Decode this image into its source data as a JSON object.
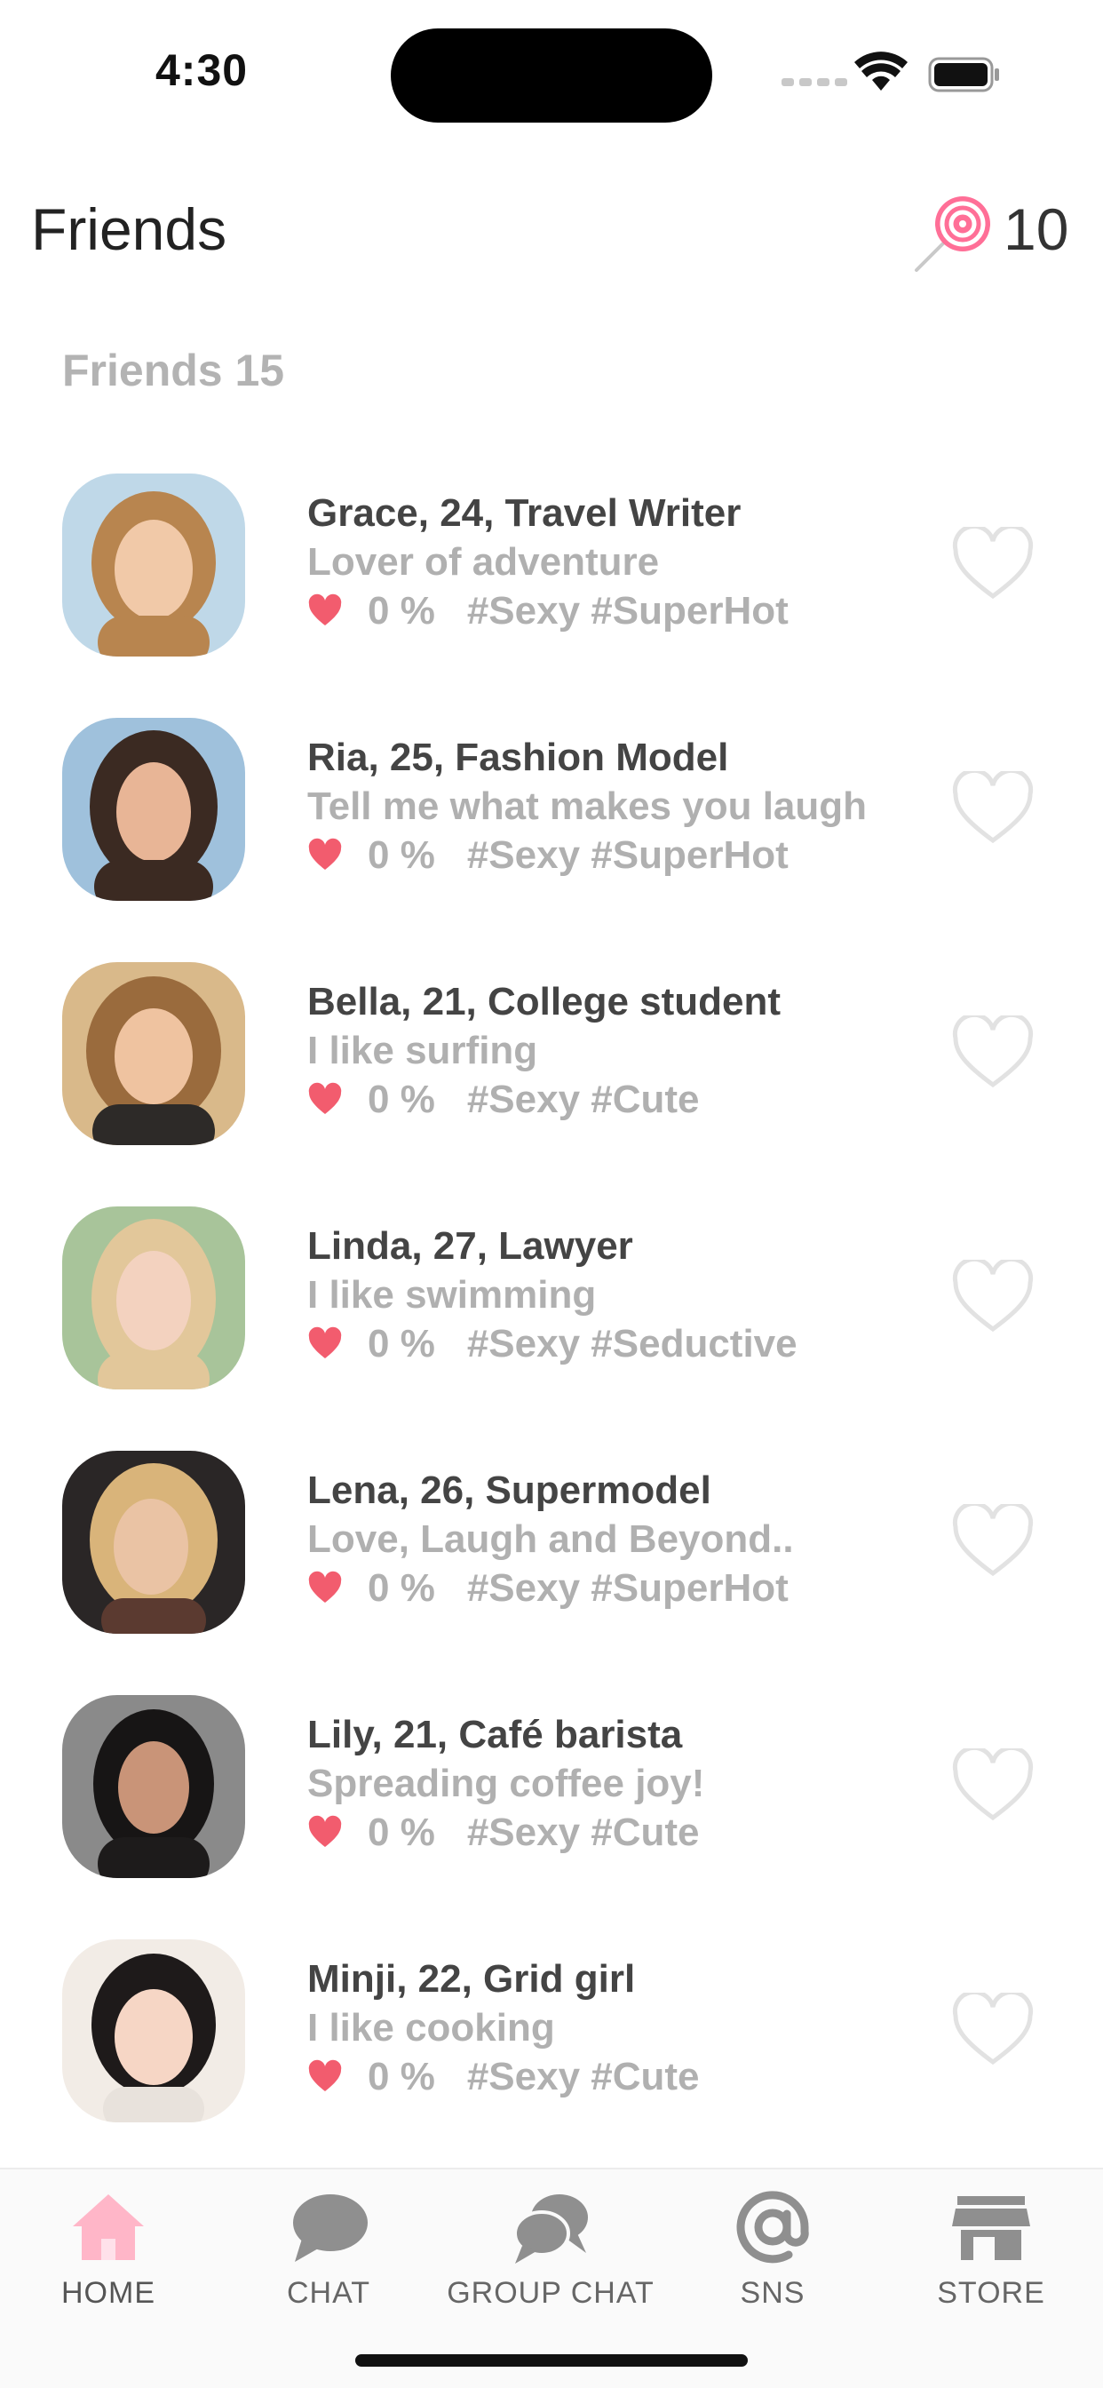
{
  "status_bar": {
    "time": "4:30"
  },
  "header": {
    "title": "Friends",
    "candy_count": "10",
    "candy_icon": "lollipop-icon"
  },
  "section": {
    "label": "Friends 15"
  },
  "colors": {
    "accent_pink": "#ffb6c8",
    "heart_red": "#f25c6e",
    "text_dark": "#444444",
    "text_light": "#b0b0b0"
  },
  "friends": [
    {
      "name": "Grace, 24, Travel Writer",
      "bio": "Lover of adventure",
      "affinity": "0 %",
      "tags": "#Sexy #SuperHot"
    },
    {
      "name": "Ria, 25, Fashion Model",
      "bio": "Tell me what makes you laugh",
      "affinity": "0 %",
      "tags": "#Sexy #SuperHot"
    },
    {
      "name": "Bella, 21, College student",
      "bio": "I like surfing",
      "affinity": "0 %",
      "tags": "#Sexy #Cute"
    },
    {
      "name": "Linda, 27, Lawyer",
      "bio": "I like swimming",
      "affinity": "0 %",
      "tags": "#Sexy #Seductive"
    },
    {
      "name": "Lena, 26, Supermodel",
      "bio": "Love, Laugh and Beyond..",
      "affinity": "0 %",
      "tags": "#Sexy #SuperHot"
    },
    {
      "name": "Lily, 21, Café barista",
      "bio": "Spreading coffee joy!",
      "affinity": "0 %",
      "tags": "#Sexy #Cute"
    },
    {
      "name": "Minji, 22, Grid girl",
      "bio": "I like cooking",
      "affinity": "0 %",
      "tags": "#Sexy #Cute"
    }
  ],
  "tab_bar": {
    "tabs": [
      {
        "label": "HOME",
        "icon": "house-icon",
        "active": true
      },
      {
        "label": "CHAT",
        "icon": "chat-bubble-icon",
        "active": false
      },
      {
        "label": "GROUP CHAT",
        "icon": "group-chat-icon",
        "active": false
      },
      {
        "label": "SNS",
        "icon": "at-sign-icon",
        "active": false
      },
      {
        "label": "STORE",
        "icon": "store-icon",
        "active": false
      }
    ]
  }
}
